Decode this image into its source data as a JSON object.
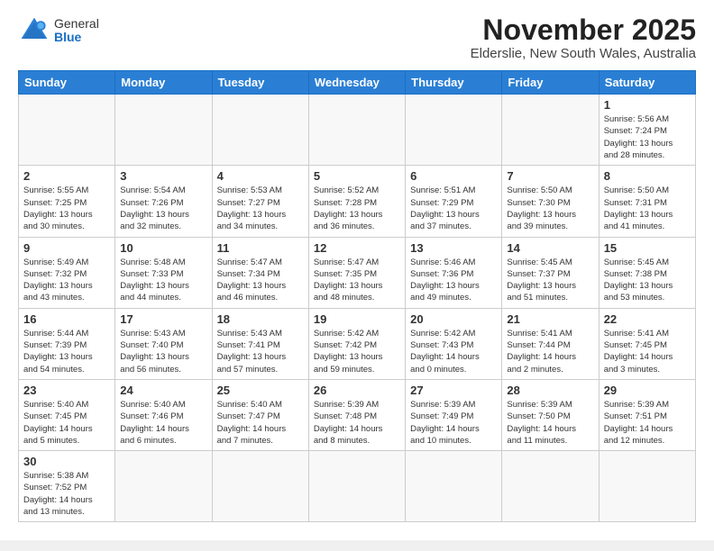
{
  "header": {
    "logo": {
      "general": "General",
      "blue": "Blue"
    },
    "title": "November 2025",
    "location": "Elderslie, New South Wales, Australia"
  },
  "weekdays": [
    "Sunday",
    "Monday",
    "Tuesday",
    "Wednesday",
    "Thursday",
    "Friday",
    "Saturday"
  ],
  "weeks": [
    [
      {
        "day": "",
        "info": ""
      },
      {
        "day": "",
        "info": ""
      },
      {
        "day": "",
        "info": ""
      },
      {
        "day": "",
        "info": ""
      },
      {
        "day": "",
        "info": ""
      },
      {
        "day": "",
        "info": ""
      },
      {
        "day": "1",
        "info": "Sunrise: 5:56 AM\nSunset: 7:24 PM\nDaylight: 13 hours\nand 28 minutes."
      }
    ],
    [
      {
        "day": "2",
        "info": "Sunrise: 5:55 AM\nSunset: 7:25 PM\nDaylight: 13 hours\nand 30 minutes."
      },
      {
        "day": "3",
        "info": "Sunrise: 5:54 AM\nSunset: 7:26 PM\nDaylight: 13 hours\nand 32 minutes."
      },
      {
        "day": "4",
        "info": "Sunrise: 5:53 AM\nSunset: 7:27 PM\nDaylight: 13 hours\nand 34 minutes."
      },
      {
        "day": "5",
        "info": "Sunrise: 5:52 AM\nSunset: 7:28 PM\nDaylight: 13 hours\nand 36 minutes."
      },
      {
        "day": "6",
        "info": "Sunrise: 5:51 AM\nSunset: 7:29 PM\nDaylight: 13 hours\nand 37 minutes."
      },
      {
        "day": "7",
        "info": "Sunrise: 5:50 AM\nSunset: 7:30 PM\nDaylight: 13 hours\nand 39 minutes."
      },
      {
        "day": "8",
        "info": "Sunrise: 5:50 AM\nSunset: 7:31 PM\nDaylight: 13 hours\nand 41 minutes."
      }
    ],
    [
      {
        "day": "9",
        "info": "Sunrise: 5:49 AM\nSunset: 7:32 PM\nDaylight: 13 hours\nand 43 minutes."
      },
      {
        "day": "10",
        "info": "Sunrise: 5:48 AM\nSunset: 7:33 PM\nDaylight: 13 hours\nand 44 minutes."
      },
      {
        "day": "11",
        "info": "Sunrise: 5:47 AM\nSunset: 7:34 PM\nDaylight: 13 hours\nand 46 minutes."
      },
      {
        "day": "12",
        "info": "Sunrise: 5:47 AM\nSunset: 7:35 PM\nDaylight: 13 hours\nand 48 minutes."
      },
      {
        "day": "13",
        "info": "Sunrise: 5:46 AM\nSunset: 7:36 PM\nDaylight: 13 hours\nand 49 minutes."
      },
      {
        "day": "14",
        "info": "Sunrise: 5:45 AM\nSunset: 7:37 PM\nDaylight: 13 hours\nand 51 minutes."
      },
      {
        "day": "15",
        "info": "Sunrise: 5:45 AM\nSunset: 7:38 PM\nDaylight: 13 hours\nand 53 minutes."
      }
    ],
    [
      {
        "day": "16",
        "info": "Sunrise: 5:44 AM\nSunset: 7:39 PM\nDaylight: 13 hours\nand 54 minutes."
      },
      {
        "day": "17",
        "info": "Sunrise: 5:43 AM\nSunset: 7:40 PM\nDaylight: 13 hours\nand 56 minutes."
      },
      {
        "day": "18",
        "info": "Sunrise: 5:43 AM\nSunset: 7:41 PM\nDaylight: 13 hours\nand 57 minutes."
      },
      {
        "day": "19",
        "info": "Sunrise: 5:42 AM\nSunset: 7:42 PM\nDaylight: 13 hours\nand 59 minutes."
      },
      {
        "day": "20",
        "info": "Sunrise: 5:42 AM\nSunset: 7:43 PM\nDaylight: 14 hours\nand 0 minutes."
      },
      {
        "day": "21",
        "info": "Sunrise: 5:41 AM\nSunset: 7:44 PM\nDaylight: 14 hours\nand 2 minutes."
      },
      {
        "day": "22",
        "info": "Sunrise: 5:41 AM\nSunset: 7:45 PM\nDaylight: 14 hours\nand 3 minutes."
      }
    ],
    [
      {
        "day": "23",
        "info": "Sunrise: 5:40 AM\nSunset: 7:45 PM\nDaylight: 14 hours\nand 5 minutes."
      },
      {
        "day": "24",
        "info": "Sunrise: 5:40 AM\nSunset: 7:46 PM\nDaylight: 14 hours\nand 6 minutes."
      },
      {
        "day": "25",
        "info": "Sunrise: 5:40 AM\nSunset: 7:47 PM\nDaylight: 14 hours\nand 7 minutes."
      },
      {
        "day": "26",
        "info": "Sunrise: 5:39 AM\nSunset: 7:48 PM\nDaylight: 14 hours\nand 8 minutes."
      },
      {
        "day": "27",
        "info": "Sunrise: 5:39 AM\nSunset: 7:49 PM\nDaylight: 14 hours\nand 10 minutes."
      },
      {
        "day": "28",
        "info": "Sunrise: 5:39 AM\nSunset: 7:50 PM\nDaylight: 14 hours\nand 11 minutes."
      },
      {
        "day": "29",
        "info": "Sunrise: 5:39 AM\nSunset: 7:51 PM\nDaylight: 14 hours\nand 12 minutes."
      }
    ],
    [
      {
        "day": "30",
        "info": "Sunrise: 5:38 AM\nSunset: 7:52 PM\nDaylight: 14 hours\nand 13 minutes."
      },
      {
        "day": "",
        "info": ""
      },
      {
        "day": "",
        "info": ""
      },
      {
        "day": "",
        "info": ""
      },
      {
        "day": "",
        "info": ""
      },
      {
        "day": "",
        "info": ""
      },
      {
        "day": "",
        "info": ""
      }
    ]
  ]
}
